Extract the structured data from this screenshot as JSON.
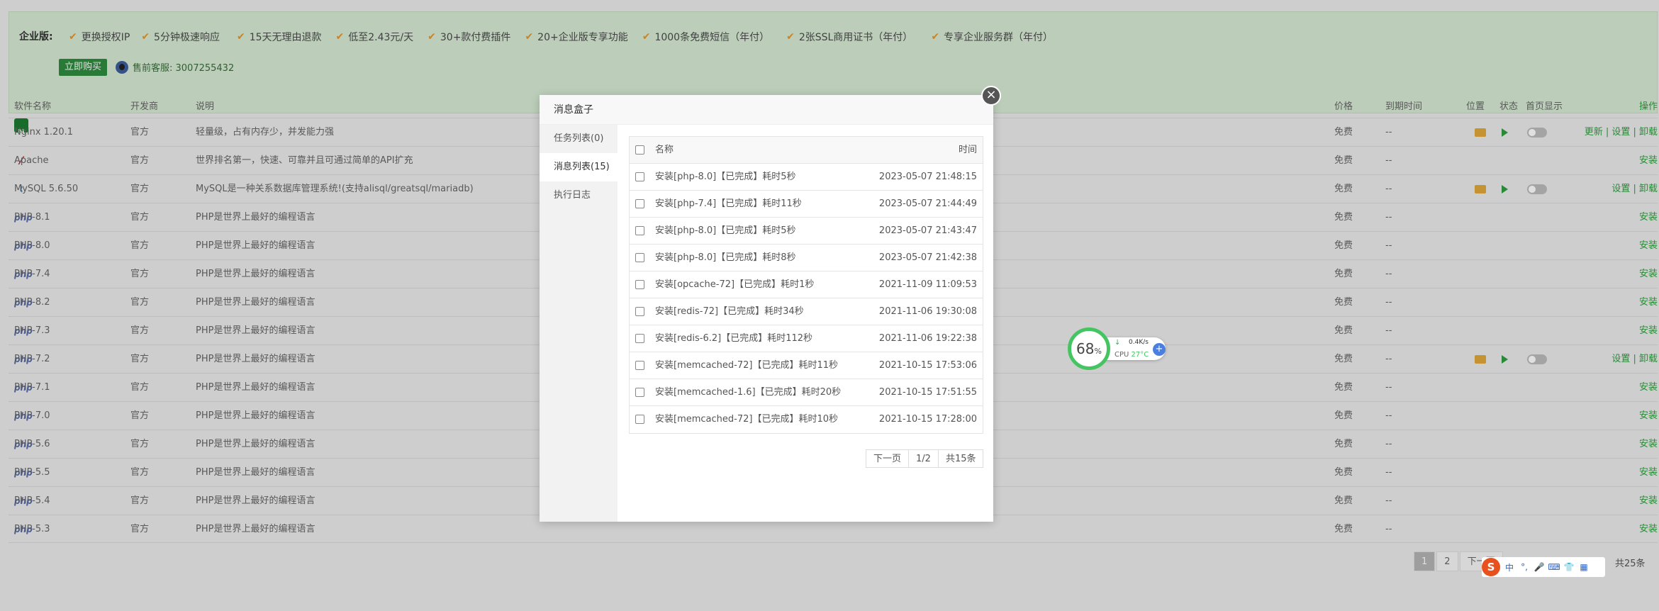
{
  "banner": {
    "label": "企业版:",
    "features": [
      "更换授权IP",
      "5分钟极速响应",
      "15天无理由退款",
      "低至2.43元/天",
      "30+款付费插件",
      "20+企业版专享功能",
      "1000条免费短信（年付）",
      "2张SSL商用证书（年付）",
      "专享企业服务群（年付）"
    ],
    "buy_label": "立即购买",
    "qq_label": "售前客服: 3007255432"
  },
  "table": {
    "headers": {
      "name": "软件名称",
      "dev": "开发商",
      "desc": "说明",
      "price": "价格",
      "expire": "到期时间",
      "position": "位置",
      "status": "状态",
      "home": "首页显示",
      "ops": "操作"
    },
    "rows": [
      {
        "name": "Nginx 1.20.1",
        "logo": "nginx-icon",
        "dev": "官方",
        "desc": "轻量级，占有内存少，并发能力强",
        "price": "免费",
        "expire": "--",
        "installed": true,
        "ops": "更新 | 设置 | 卸载"
      },
      {
        "name": "Apache",
        "logo": "apache-icon",
        "dev": "官方",
        "desc": "世界排名第一，快速、可靠并且可通过简单的API扩充",
        "price": "免费",
        "expire": "--",
        "installed": false,
        "ops": "安装"
      },
      {
        "name": "MySQL 5.6.50",
        "logo": "mysql-icon",
        "dev": "官方",
        "desc": "MySQL是一种关系数据库管理系统!(支持alisql/greatsql/mariadb)",
        "price": "免费",
        "expire": "--",
        "installed": true,
        "ops": "设置 | 卸载"
      },
      {
        "name": "PHP-8.1",
        "logo": "php-icon",
        "dev": "官方",
        "desc": "PHP是世界上最好的编程语言",
        "price": "免费",
        "expire": "--",
        "installed": false,
        "ops": "安装"
      },
      {
        "name": "PHP-8.0",
        "logo": "php-icon",
        "dev": "官方",
        "desc": "PHP是世界上最好的编程语言",
        "price": "免费",
        "expire": "--",
        "installed": false,
        "ops": "安装"
      },
      {
        "name": "PHP-7.4",
        "logo": "php-icon",
        "dev": "官方",
        "desc": "PHP是世界上最好的编程语言",
        "price": "免费",
        "expire": "--",
        "installed": false,
        "ops": "安装"
      },
      {
        "name": "PHP-8.2",
        "logo": "php-icon",
        "dev": "官方",
        "desc": "PHP是世界上最好的编程语言",
        "price": "免费",
        "expire": "--",
        "installed": false,
        "ops": "安装"
      },
      {
        "name": "PHP-7.3",
        "logo": "php-icon",
        "dev": "官方",
        "desc": "PHP是世界上最好的编程语言",
        "price": "免费",
        "expire": "--",
        "installed": false,
        "ops": "安装"
      },
      {
        "name": "PHP-7.2",
        "logo": "php-icon",
        "dev": "官方",
        "desc": "PHP是世界上最好的编程语言",
        "price": "免费",
        "expire": "--",
        "installed": true,
        "ops": "设置 | 卸载"
      },
      {
        "name": "PHP-7.1",
        "logo": "php-icon",
        "dev": "官方",
        "desc": "PHP是世界上最好的编程语言",
        "price": "免费",
        "expire": "--",
        "installed": false,
        "ops": "安装"
      },
      {
        "name": "PHP-7.0",
        "logo": "php-icon",
        "dev": "官方",
        "desc": "PHP是世界上最好的编程语言",
        "price": "免费",
        "expire": "--",
        "installed": false,
        "ops": "安装"
      },
      {
        "name": "PHP-5.6",
        "logo": "php-icon",
        "dev": "官方",
        "desc": "PHP是世界上最好的编程语言",
        "price": "免费",
        "expire": "--",
        "installed": false,
        "ops": "安装"
      },
      {
        "name": "PHP-5.5",
        "logo": "php-icon",
        "dev": "官方",
        "desc": "PHP是世界上最好的编程语言",
        "price": "免费",
        "expire": "--",
        "installed": false,
        "ops": "安装"
      },
      {
        "name": "PHP-5.4",
        "logo": "php-icon",
        "dev": "官方",
        "desc": "PHP是世界上最好的编程语言",
        "price": "免费",
        "expire": "--",
        "installed": false,
        "ops": "安装"
      },
      {
        "name": "PHP-5.3",
        "logo": "php-icon",
        "dev": "官方",
        "desc": "PHP是世界上最好的编程语言",
        "price": "免费",
        "expire": "--",
        "installed": false,
        "ops": "安装"
      }
    ]
  },
  "pager": {
    "pages": [
      "1",
      "2"
    ],
    "next": "下一页",
    "total": "共25条"
  },
  "modal": {
    "title": "消息盒子",
    "close_glyph": "×",
    "tabs": [
      "任务列表(0)",
      "消息列表(15)",
      "执行日志"
    ],
    "active_tab": 1,
    "headers": {
      "name": "名称",
      "time": "时间"
    },
    "messages": [
      {
        "name": "安装[php-8.0]【已完成】耗时5秒",
        "time": "2023-05-07 21:48:15"
      },
      {
        "name": "安装[php-7.4]【已完成】耗时11秒",
        "time": "2023-05-07 21:44:49"
      },
      {
        "name": "安装[php-8.0]【已完成】耗时5秒",
        "time": "2023-05-07 21:43:47"
      },
      {
        "name": "安装[php-8.0]【已完成】耗时8秒",
        "time": "2023-05-07 21:42:38"
      },
      {
        "name": "安装[opcache-72]【已完成】耗时1秒",
        "time": "2021-11-09 11:09:53"
      },
      {
        "name": "安装[redis-72]【已完成】耗时34秒",
        "time": "2021-11-06 19:30:08"
      },
      {
        "name": "安装[redis-6.2]【已完成】耗时112秒",
        "time": "2021-11-06 19:22:38"
      },
      {
        "name": "安装[memcached-72]【已完成】耗时11秒",
        "time": "2021-10-15 17:53:06"
      },
      {
        "name": "安装[memcached-1.6]【已完成】耗时20秒",
        "time": "2021-10-15 17:51:55"
      },
      {
        "name": "安装[memcached-72]【已完成】耗时10秒",
        "time": "2021-10-15 17:28:00"
      }
    ],
    "pager": {
      "next": "下一页",
      "page": "1/2",
      "total": "共15条"
    }
  },
  "cpu_widget": {
    "percent": "68",
    "unit": "%",
    "net": "0.4K/s",
    "cpu_label": "CPU",
    "temp": "27°C"
  },
  "ime": {
    "logo": "S",
    "items": [
      "中",
      "°,",
      "🎤",
      "⌨",
      "👕",
      "▦"
    ]
  }
}
